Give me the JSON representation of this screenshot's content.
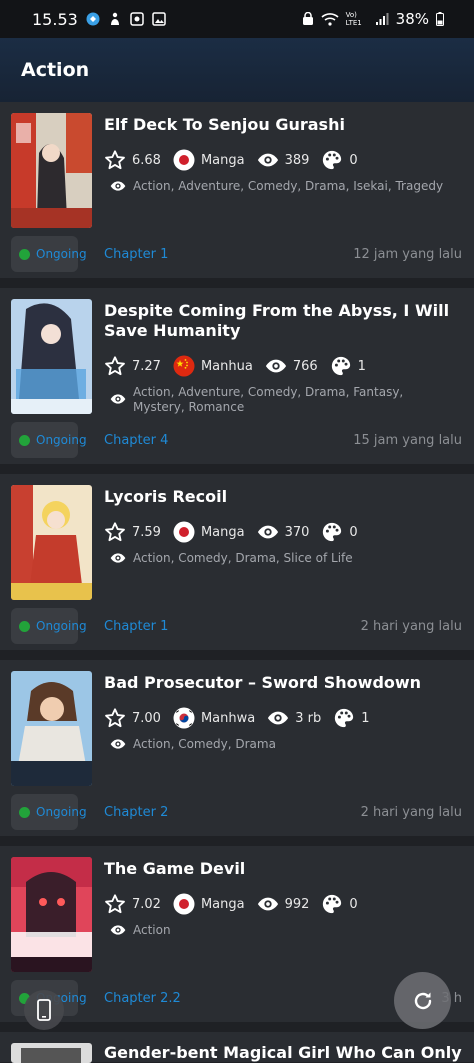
{
  "status_bar": {
    "time": "15.53",
    "battery": "38%",
    "network_label": "Vo) LTE1"
  },
  "app_bar": {
    "title": "Action"
  },
  "comics": [
    {
      "title": "Elf Deck To Senjou Gurashi",
      "rating": "6.68",
      "type": "Manga",
      "country": "japan",
      "views": "389",
      "palette_count": "0",
      "genres": "Action, Adventure, Comedy, Drama, Isekai, Tragedy",
      "status": "Ongoing",
      "chapter": "Chapter 1",
      "updated": "12 jam yang lalu"
    },
    {
      "title": "Despite Coming From the Abyss, I Will Save Humanity",
      "rating": "7.27",
      "type": "Manhua",
      "country": "china",
      "views": "766",
      "palette_count": "1",
      "genres": "Action, Adventure, Comedy, Drama, Fantasy, Mystery, Romance",
      "status": "Ongoing",
      "chapter": "Chapter 4",
      "updated": "15 jam yang lalu"
    },
    {
      "title": "Lycoris Recoil",
      "rating": "7.59",
      "type": "Manga",
      "country": "japan",
      "views": "370",
      "palette_count": "0",
      "genres": "Action, Comedy, Drama, Slice of Life",
      "status": "Ongoing",
      "chapter": "Chapter 1",
      "updated": "2 hari yang lalu"
    },
    {
      "title": "Bad Prosecutor – Sword Showdown",
      "rating": "7.00",
      "type": "Manhwa",
      "country": "korea",
      "views": "3 rb",
      "palette_count": "1",
      "genres": "Action, Comedy, Drama",
      "status": "Ongoing",
      "chapter": "Chapter 2",
      "updated": "2 hari yang lalu"
    },
    {
      "title": "The Game Devil",
      "rating": "7.02",
      "type": "Manga",
      "country": "japan",
      "views": "992",
      "palette_count": "0",
      "genres": "Action",
      "status": "Ongoing",
      "chapter": "Chapter 2.2",
      "updated": "3 h"
    }
  ],
  "partial_next_title": "Gender-bent Magical Girl Who Can Only",
  "colors": {
    "background": "#1f2125",
    "card": "#2a2d32",
    "accent_blue": "#1f8ad6",
    "status_green": "#22a33a"
  }
}
